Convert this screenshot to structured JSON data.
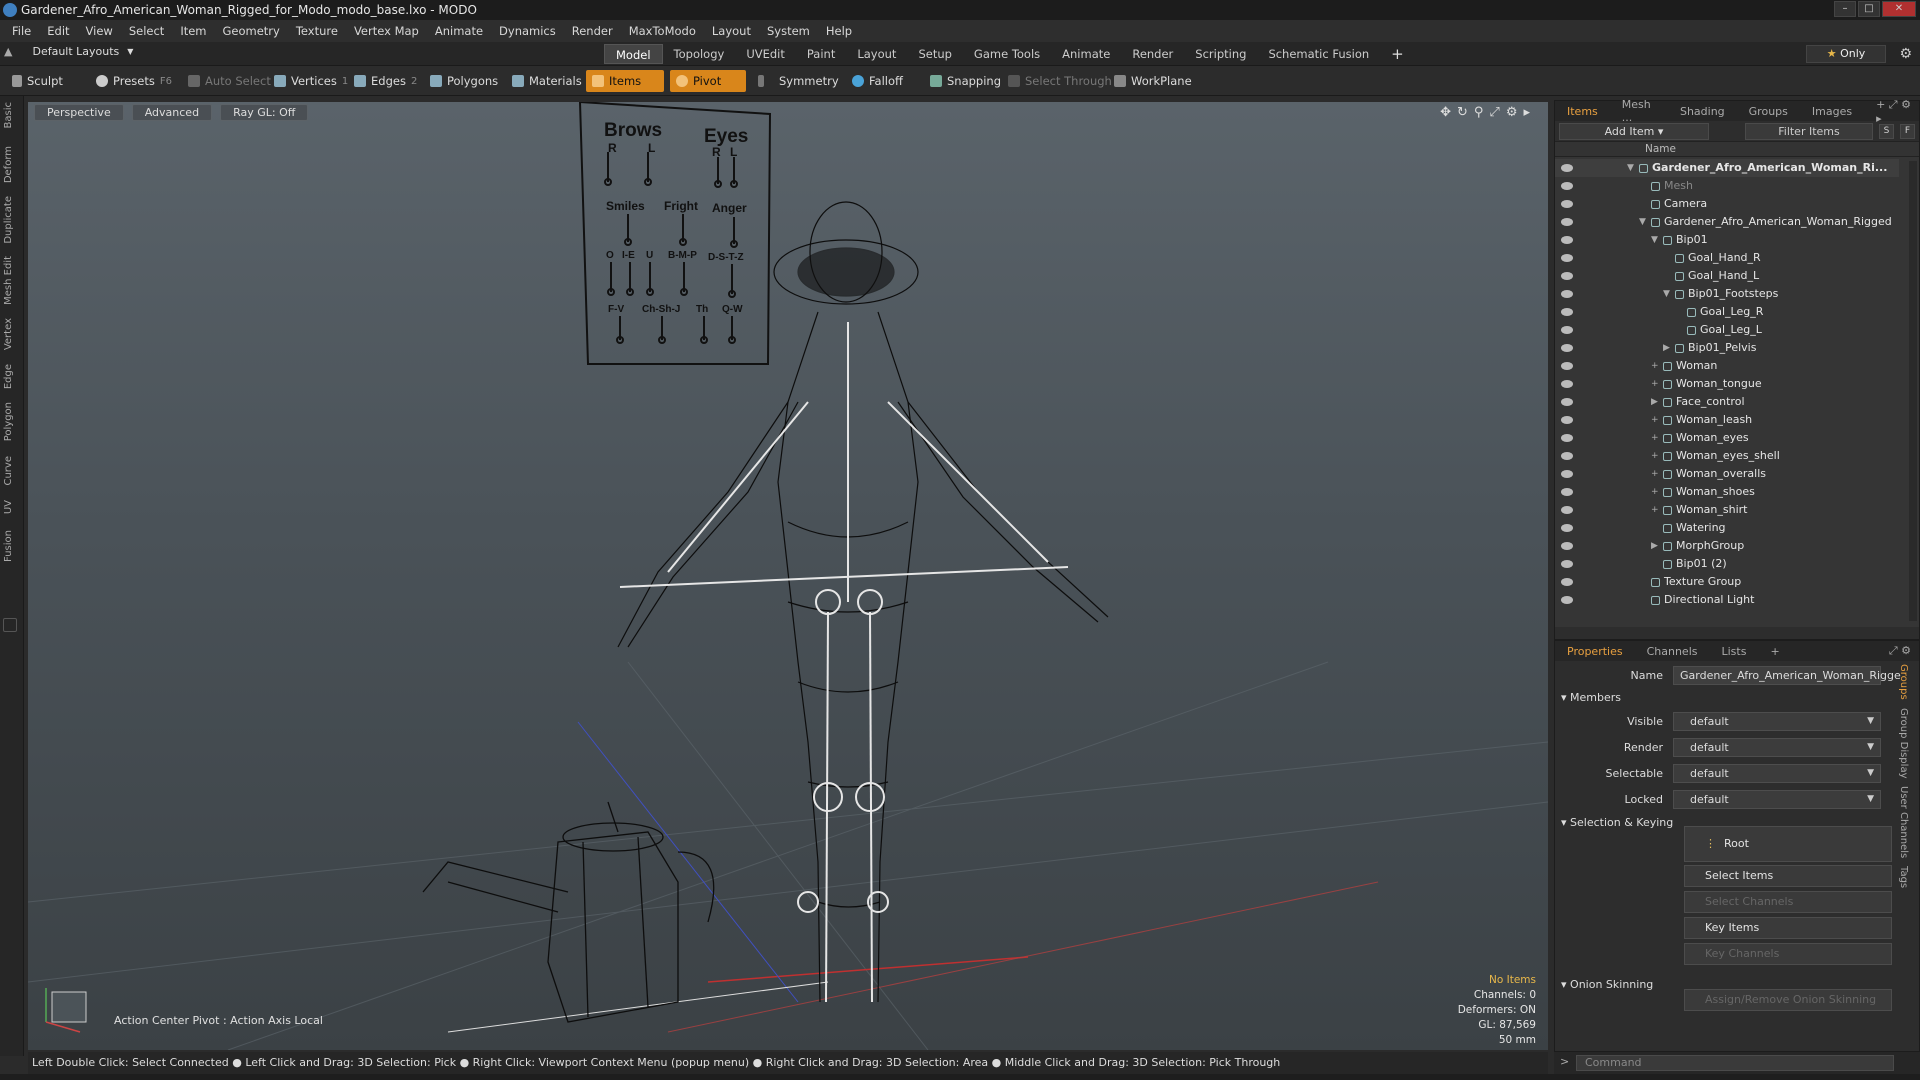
{
  "window": {
    "title": "Gardener_Afro_American_Woman_Rigged_for_Modo_modo_base.lxo - MODO"
  },
  "menu": [
    "File",
    "Edit",
    "View",
    "Select",
    "Item",
    "Geometry",
    "Texture",
    "Vertex Map",
    "Animate",
    "Dynamics",
    "Render",
    "MaxToModo",
    "Layout",
    "System",
    "Help"
  ],
  "layout": {
    "selector": "Default Layouts",
    "tabs": [
      "Model",
      "Topology",
      "UVEdit",
      "Paint",
      "Layout",
      "Setup",
      "Game Tools",
      "Animate",
      "Render",
      "Scripting",
      "Schematic Fusion"
    ],
    "active_tab": "Model",
    "only_label": "Only"
  },
  "toolbar": {
    "sculpt": "Sculpt",
    "presets": "Presets",
    "presets_key": "F6",
    "auto_select": "Auto Select",
    "vertices": "Vertices",
    "vertices_count": "1",
    "edges": "Edges",
    "edges_count": "2",
    "polygons": "Polygons",
    "materials": "Materials",
    "items": "Items",
    "pivot": "Pivot",
    "symmetry": "Symmetry",
    "falloff": "Falloff",
    "snapping": "Snapping",
    "select_through": "Select Through",
    "workplane": "WorkPlane"
  },
  "left_tabs": [
    "Basic",
    "Deform",
    "Duplicate",
    "Mesh Edit",
    "Vertex",
    "Edge",
    "Polygon",
    "Curve",
    "UV",
    "Fusion"
  ],
  "viewport": {
    "projection": "Perspective",
    "shading": "Advanced",
    "raygl": "Ray GL: Off",
    "action_center": "Action Center Pivot : Action Axis Local",
    "info": {
      "no_items": "No Items",
      "channels": "Channels: 0",
      "deformers": "Deformers: ON",
      "gl": "GL: 87,569",
      "lens": "50 mm"
    },
    "face_board": {
      "brows": "Brows",
      "eyes": "Eyes",
      "r": "R",
      "l": "L",
      "smiles": "Smiles",
      "fright": "Fright",
      "anger": "Anger",
      "o": "O",
      "ie": "I-E",
      "u": "U",
      "bmp": "B-M-P",
      "dstz": "D-S-T-Z",
      "fv": "F-V",
      "chshj": "Ch-Sh-J",
      "th": "Th",
      "qw": "Q-W"
    }
  },
  "status": "Left Double Click: Select Connected ● Left Click and Drag: 3D Selection: Pick ● Right Click: Viewport Context Menu (popup menu) ● Right Click and Drag: 3D Selection: Area ● Middle Click and Drag: 3D Selection: Pick Through",
  "items_panel": {
    "tabs": [
      "Items",
      "Mesh ...",
      "Shading",
      "Groups",
      "Images"
    ],
    "active_tab": "Items",
    "add_item": "Add Item",
    "filter": "Filter Items",
    "s": "S",
    "f": "F",
    "col_name": "Name",
    "rows": [
      {
        "label": "Gardener_Afro_American_Woman_Ri...",
        "depth": 0,
        "twisty": "▼",
        "bold": true
      },
      {
        "label": "Mesh",
        "depth": 1,
        "twisty": "",
        "dim": true
      },
      {
        "label": "Camera",
        "depth": 1,
        "twisty": ""
      },
      {
        "label": "Gardener_Afro_American_Woman_Rigged",
        "depth": 1,
        "twisty": "▼"
      },
      {
        "label": "Bip01",
        "depth": 2,
        "twisty": "▼"
      },
      {
        "label": "Goal_Hand_R",
        "depth": 3,
        "twisty": ""
      },
      {
        "label": "Goal_Hand_L",
        "depth": 3,
        "twisty": ""
      },
      {
        "label": "Bip01_Footsteps",
        "depth": 3,
        "twisty": "▼"
      },
      {
        "label": "Goal_Leg_R",
        "depth": 4,
        "twisty": ""
      },
      {
        "label": "Goal_Leg_L",
        "depth": 4,
        "twisty": ""
      },
      {
        "label": "Bip01_Pelvis",
        "depth": 3,
        "twisty": "▶"
      },
      {
        "label": "Woman",
        "depth": 2,
        "twisty": "+"
      },
      {
        "label": "Woman_tongue",
        "depth": 2,
        "twisty": "+"
      },
      {
        "label": "Face_control",
        "depth": 2,
        "twisty": "▶"
      },
      {
        "label": "Woman_leash",
        "depth": 2,
        "twisty": "+"
      },
      {
        "label": "Woman_eyes",
        "depth": 2,
        "twisty": "+"
      },
      {
        "label": "Woman_eyes_shell",
        "depth": 2,
        "twisty": "+"
      },
      {
        "label": "Woman_overalls",
        "depth": 2,
        "twisty": "+"
      },
      {
        "label": "Woman_shoes",
        "depth": 2,
        "twisty": "+"
      },
      {
        "label": "Woman_shirt",
        "depth": 2,
        "twisty": "+"
      },
      {
        "label": "Watering",
        "depth": 2,
        "twisty": ""
      },
      {
        "label": "MorphGroup",
        "depth": 2,
        "twisty": "▶"
      },
      {
        "label": "Bip01 (2)",
        "depth": 2,
        "twisty": ""
      },
      {
        "label": "Texture Group",
        "depth": 1,
        "twisty": ""
      },
      {
        "label": "Directional Light",
        "depth": 1,
        "twisty": ""
      }
    ]
  },
  "properties": {
    "tabs": [
      "Properties",
      "Channels",
      "Lists"
    ],
    "active_tab": "Properties",
    "name_label": "Name",
    "name_value": "Gardener_Afro_American_Woman_Rigge",
    "members": "Members",
    "fields": [
      {
        "label": "Visible",
        "value": "default"
      },
      {
        "label": "Render",
        "value": "default"
      },
      {
        "label": "Selectable",
        "value": "default"
      },
      {
        "label": "Locked",
        "value": "default"
      }
    ],
    "sel_keying": "Selection & Keying",
    "root": "Root",
    "select_items": "Select Items",
    "select_channels": "Select Channels",
    "key_items": "Key Items",
    "key_channels": "Key Channels",
    "onion": "Onion Skinning",
    "assign_onion": "Assign/Remove Onion Skinning",
    "side_tabs": [
      "Groups",
      "Group Display",
      "User Channels",
      "Tags"
    ]
  },
  "command": {
    "placeholder": "Command"
  },
  "colors": {
    "accent_orange": "#d9861b",
    "active_tab_orange": "#e8a040",
    "noitems": "#e8b84a"
  }
}
